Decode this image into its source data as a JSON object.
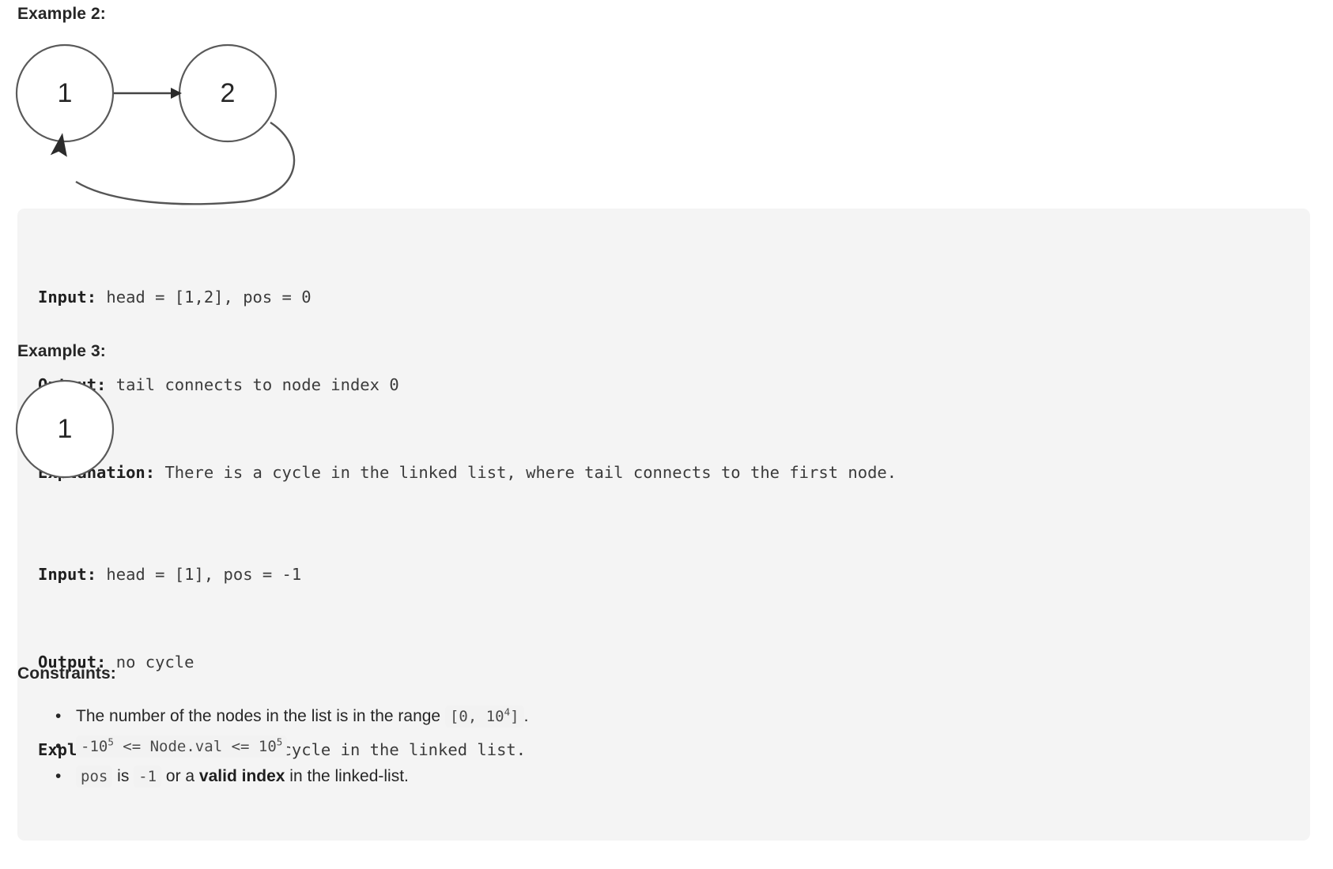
{
  "examples": [
    {
      "heading": "Example 2:",
      "diagram": {
        "nodes": [
          {
            "label": "1"
          },
          {
            "label": "2"
          }
        ],
        "edges": [
          {
            "from": "1",
            "to": "2",
            "type": "straight-arrow"
          },
          {
            "from": "2",
            "to": "1",
            "type": "cycle-curve-arrow"
          }
        ]
      },
      "code": {
        "input_key": "Input:",
        "input_value": " head = [1,2], pos = 0",
        "output_key": "Output:",
        "output_value": " tail connects to node index 0",
        "explanation_key": "Explanation:",
        "explanation_value": " There is a cycle in the linked list, where tail connects to the first node."
      }
    },
    {
      "heading": "Example 3:",
      "diagram": {
        "nodes": [
          {
            "label": "1"
          }
        ],
        "edges": []
      },
      "code": {
        "input_key": "Input:",
        "input_value": " head = [1], pos = -1",
        "output_key": "Output:",
        "output_value": " no cycle",
        "explanation_key": "Explanation:",
        "explanation_value": " There is no cycle in the linked list."
      }
    }
  ],
  "constraints": {
    "heading": "Constraints:",
    "items": [
      {
        "bullet": "•",
        "parts": [
          {
            "type": "text",
            "value": "The number of the nodes in the list is in the range "
          },
          {
            "type": "code",
            "value": "[0, 10",
            "sup": "4",
            "suffix": "]"
          },
          {
            "type": "text",
            "value": "."
          }
        ]
      },
      {
        "bullet": "•",
        "parts": [
          {
            "type": "code_full",
            "value": "-10",
            "sup": "5",
            "mid": " <= Node.val <= 10",
            "sup2": "5"
          }
        ]
      },
      {
        "bullet": "•",
        "parts": [
          {
            "type": "code",
            "value": "pos"
          },
          {
            "type": "text",
            "value": " is "
          },
          {
            "type": "code",
            "value": "-1"
          },
          {
            "type": "text",
            "value": " or a "
          },
          {
            "type": "bold",
            "value": "valid index"
          },
          {
            "type": "text",
            "value": " in the linked-list."
          }
        ]
      }
    ]
  },
  "colors": {
    "code_block_background": "#f4f4f4",
    "inline_code_background": "#f2f2f2",
    "text": "#262626",
    "node_stroke": "#5a5a5a",
    "edge_stroke": "#444444"
  }
}
